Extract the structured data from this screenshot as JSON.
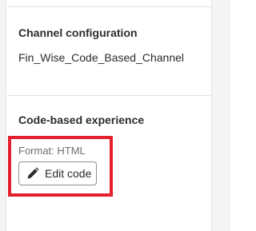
{
  "channel_config": {
    "heading": "Channel configuration",
    "value": "Fin_Wise_Code_Based_Channel"
  },
  "code_experience": {
    "heading": "Code-based experience",
    "format_label": "Format: HTML",
    "edit_button_label": "Edit code",
    "edit_icon": "pencil-icon"
  },
  "colors": {
    "highlight": "#e4202c",
    "heading_text": "#2c2c2c",
    "muted_text": "#6e6e6e",
    "button_border": "#8e8e8e"
  }
}
